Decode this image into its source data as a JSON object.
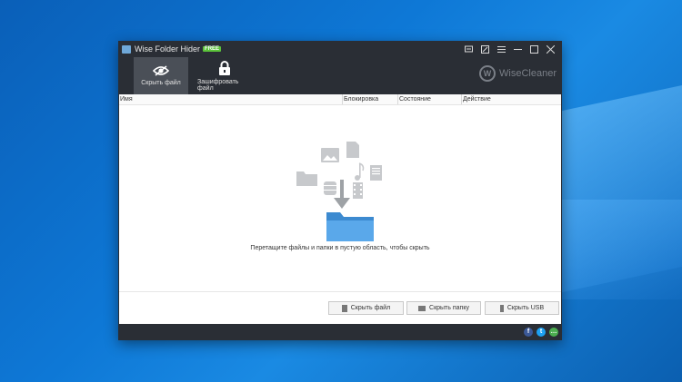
{
  "window": {
    "title": "Wise Folder Hider",
    "badge": "FREE",
    "controls": [
      "feedback-icon",
      "edit-icon",
      "menu-icon",
      "minimize-icon",
      "maximize-icon",
      "close-icon"
    ]
  },
  "toolbar": {
    "hide_file": "Скрыть файл",
    "encrypt_file": "Зашифровать файл",
    "brand": "WiseCleaner",
    "brand_letter": "W"
  },
  "table": {
    "columns": [
      "Имя",
      "Блокировка",
      "Состояние",
      "Действие"
    ]
  },
  "empty_state": {
    "text": "Перетащите файлы и папки в пустую область, чтобы скрыть"
  },
  "footer": {
    "hide_file_btn": "Скрыть файл",
    "hide_folder_btn": "Скрыть папку",
    "hide_usb_btn": "Скрыть USB"
  },
  "social": {
    "facebook": "f",
    "twitter": "t",
    "chat": "…"
  },
  "colors": {
    "app_bg": "#2a2e35",
    "active_tab": "#4a4f57",
    "folder_blue": "#4a9be0",
    "free_badge": "#5cc33b",
    "desktop": "#0e78d6"
  }
}
